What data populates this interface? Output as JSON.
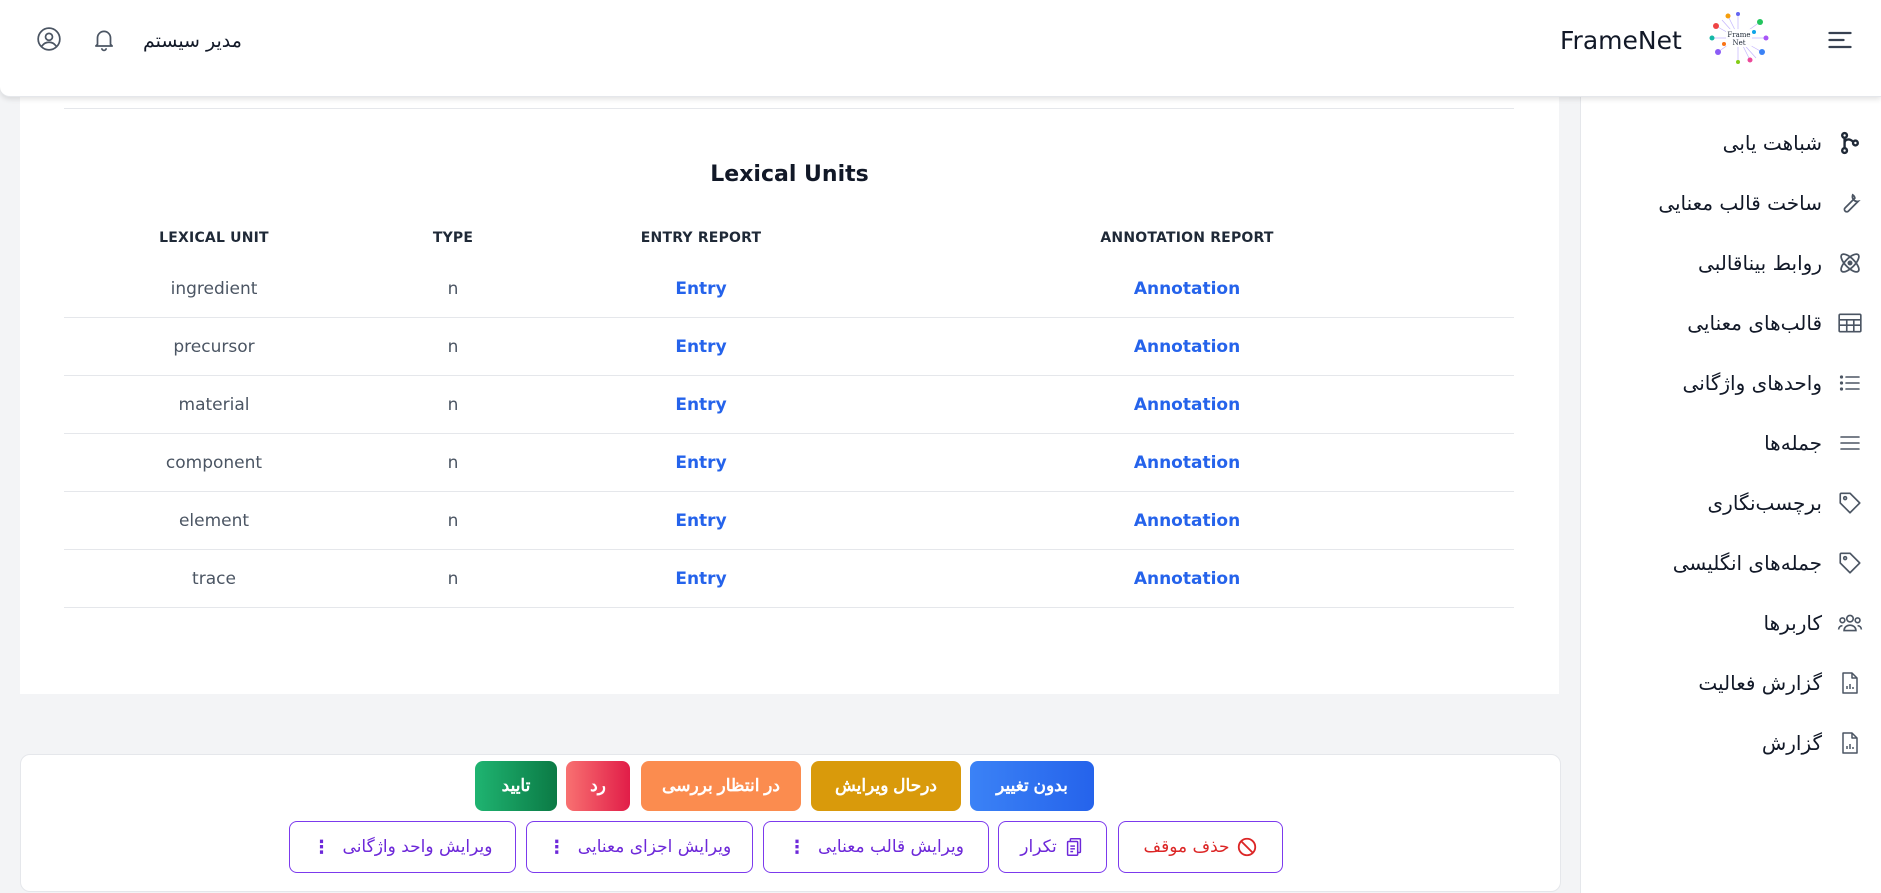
{
  "header": {
    "brand": "FrameNet",
    "user_name": "مدیر سیستم"
  },
  "sidebar": {
    "items": [
      {
        "label": "شباهت یابی",
        "icon": "git-branch-icon"
      },
      {
        "label": "ساخت قالب معنایی",
        "icon": "wrench-icon"
      },
      {
        "label": "روابط بیناقالبی",
        "icon": "atom-icon"
      },
      {
        "label": "قالب‌های معنایی",
        "icon": "table-icon"
      },
      {
        "label": "واحدهای واژگانی",
        "icon": "list-icon"
      },
      {
        "label": "جمله‌ها",
        "icon": "lines-icon"
      },
      {
        "label": "برچسب‌نگاری",
        "icon": "tag-icon"
      },
      {
        "label": "جمله‌های انگلیسی",
        "icon": "tag-icon"
      },
      {
        "label": "کاربرها",
        "icon": "users-icon"
      },
      {
        "label": "گزارش فعالیت",
        "icon": "report-icon"
      },
      {
        "label": "گزارش",
        "icon": "report-icon"
      }
    ]
  },
  "lexical_units": {
    "title": "Lexical Units",
    "columns": [
      "LEXICAL UNIT",
      "TYPE",
      "ENTRY REPORT",
      "ANNOTATION REPORT"
    ],
    "rows": [
      {
        "unit": "ingredient",
        "type": "n",
        "entry": "Entry",
        "annotation": "Annotation"
      },
      {
        "unit": "precursor",
        "type": "n",
        "entry": "Entry",
        "annotation": "Annotation"
      },
      {
        "unit": "material",
        "type": "n",
        "entry": "Entry",
        "annotation": "Annotation"
      },
      {
        "unit": "component",
        "type": "n",
        "entry": "Entry",
        "annotation": "Annotation"
      },
      {
        "unit": "element",
        "type": "n",
        "entry": "Entry",
        "annotation": "Annotation"
      },
      {
        "unit": "trace",
        "type": "n",
        "entry": "Entry",
        "annotation": "Annotation"
      }
    ]
  },
  "status_buttons": {
    "unchanged": "بدون تغییر",
    "editing": "درحال ویرایش",
    "pending": "در انتظار بررسی",
    "reject": "رد",
    "approve": "تایید"
  },
  "action_buttons": {
    "delete_pending": "حذف موقف",
    "duplicate": "تکرار",
    "edit_frame": "ویرایش قالب معنایی",
    "edit_elements": "ویرایش اجزای معنایی",
    "edit_unit": "ویرایش واحد واژگانی",
    "more": "⋮"
  },
  "colors": {
    "unchanged": "#2563eb",
    "editing": "#d99a0b",
    "pending": "#fb8c4f",
    "reject": "#ef4444",
    "approve": "#12935a",
    "link": "#2563eb",
    "outline": "#7c3aed"
  }
}
